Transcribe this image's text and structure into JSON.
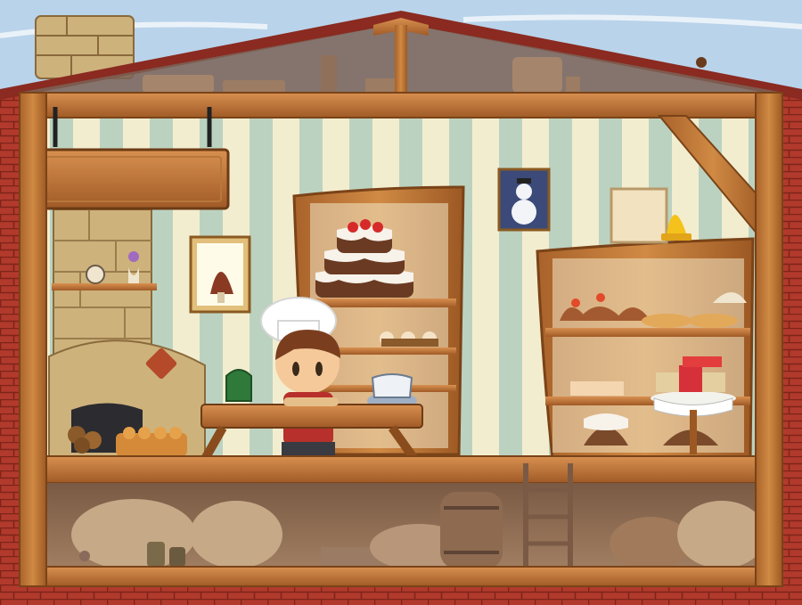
{
  "scene": {
    "type": "bakery cutaway illustration",
    "colors": {
      "sky": "#b9d3ea",
      "brick": "#b13a2c",
      "brick_mortar": "#8d2a20",
      "roof": "#8a2a20",
      "wood": "#c47a34",
      "wood_dark": "#8a4c1c",
      "wallpaper_light": "#f3edcf",
      "wallpaper_stripe": "#bcd2c0",
      "cellar": "#8c6a52",
      "stone": "#cdb27c"
    },
    "sign": {
      "text": ""
    }
  }
}
